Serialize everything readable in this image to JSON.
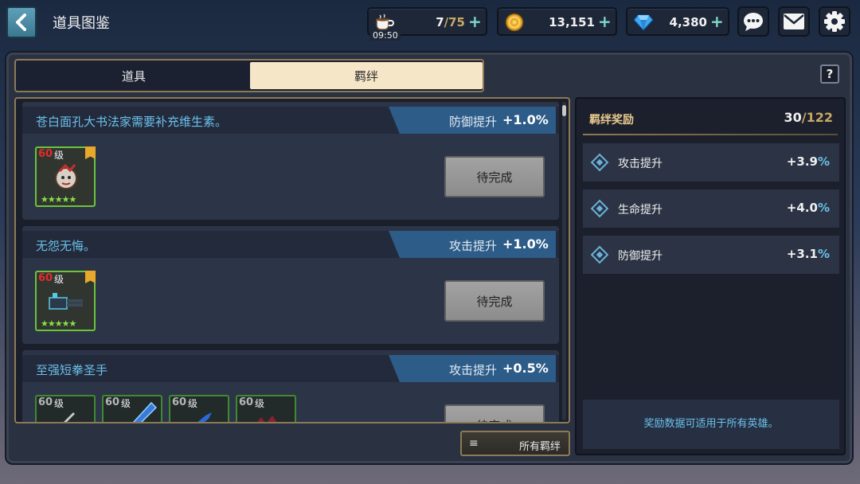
{
  "header": {
    "title": "道具图鉴",
    "stamina": {
      "current": "7",
      "max": "/75",
      "timer": "09:50",
      "icon": "coffee-cup-icon"
    },
    "gold": {
      "value": "13,151",
      "icon": "gold-coin-icon"
    },
    "gems": {
      "value": "4,380",
      "icon": "diamond-gem-icon"
    },
    "plus": "+"
  },
  "tabs": [
    {
      "label": "道具",
      "active": false
    },
    {
      "label": "羁绊",
      "active": true
    }
  ],
  "help_label": "?",
  "bonds": [
    {
      "name": "苍白面孔大书法家需要补充维生素。",
      "stat": "防御提升",
      "bonus": "+1.0%",
      "button": "待完成",
      "items": [
        {
          "level": "60",
          "unit": "级",
          "stars": "★★★★★",
          "icon": "masked-doll-icon"
        }
      ]
    },
    {
      "name": "无怨无悔。",
      "stat": "攻击提升",
      "bonus": "+1.0%",
      "button": "待完成",
      "items": [
        {
          "level": "60",
          "unit": "级",
          "stars": "★★★★★",
          "icon": "gatling-gun-icon"
        }
      ]
    },
    {
      "name": "至强短拳圣手",
      "stat": "攻击提升",
      "bonus": "+0.5%",
      "button": "待完成",
      "items": [
        {
          "level": "60",
          "unit": "级",
          "icon": "knife-icon"
        },
        {
          "level": "60",
          "unit": "级",
          "icon": "blue-gauntlet-icon"
        },
        {
          "level": "60",
          "unit": "级",
          "icon": "blue-claw-icon"
        },
        {
          "level": "60",
          "unit": "级",
          "icon": "red-claw-icon"
        }
      ]
    }
  ],
  "all_bonds_label": "所有羁绊",
  "rewards": {
    "title": "羁绊奖励",
    "count": "30",
    "total": "/122",
    "rows": [
      {
        "name": "攻击提升",
        "value": "+3.9",
        "pct": "%"
      },
      {
        "name": "生命提升",
        "value": "+4.0",
        "pct": "%"
      },
      {
        "name": "防御提升",
        "value": "+3.1",
        "pct": "%"
      }
    ],
    "note": "奖励数据可适用于所有英雄。"
  },
  "colors": {
    "accent_blue": "#6ac0ea",
    "gold_border": "#8c7a57",
    "item_green": "#6cc33b",
    "level_red": "#e52b2b"
  }
}
